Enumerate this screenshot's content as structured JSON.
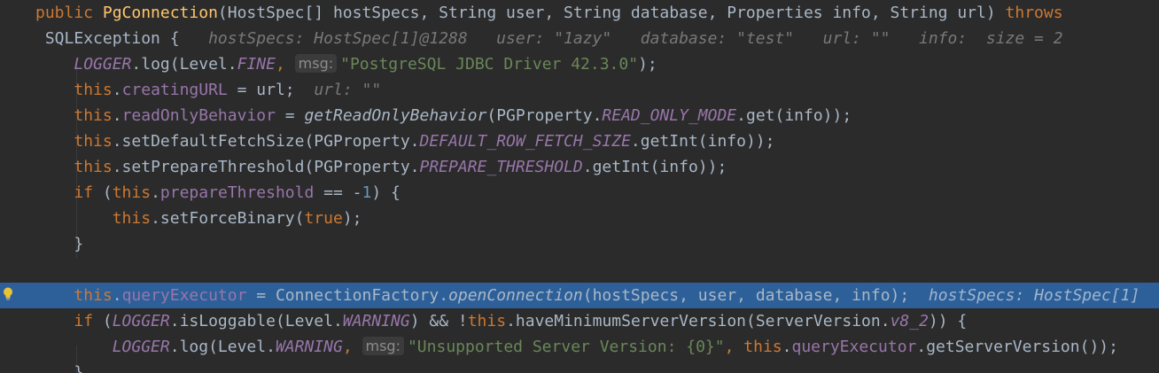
{
  "editor": {
    "lines": [
      {
        "indent": "",
        "tokens": [
          {
            "t": "public ",
            "c": "kw"
          },
          {
            "t": "PgConnection",
            "c": "ctor"
          },
          {
            "t": "(HostSpec[] hostSpecs, String user, String database, Properties info, String url) ",
            "c": "plain"
          },
          {
            "t": "throws",
            "c": "kw"
          }
        ]
      },
      {
        "indent": " ",
        "tokens": [
          {
            "t": "SQLException {",
            "c": "plain"
          },
          {
            "t": "   hostSpecs: HostSpec[1]@1288   user: \"1azy\"   database: \"test\"   url: \"\"   info:  size = 2",
            "c": "hint"
          }
        ]
      },
      {
        "indent": "    ",
        "tokens": [
          {
            "t": "LOGGER",
            "c": "sfield"
          },
          {
            "t": ".log(Level.",
            "c": "plain"
          },
          {
            "t": "FINE",
            "c": "sfield"
          },
          {
            "t": ", ",
            "c": "kw"
          },
          {
            "t": "msg:",
            "c": "param-hint"
          },
          {
            "t": "\"PostgreSQL JDBC Driver 42.3.0\"",
            "c": "str"
          },
          {
            "t": ");",
            "c": "plain"
          }
        ]
      },
      {
        "indent": "    ",
        "tokens": [
          {
            "t": "this",
            "c": "kw"
          },
          {
            "t": ".",
            "c": "plain"
          },
          {
            "t": "creatingURL",
            "c": "field"
          },
          {
            "t": " = url;",
            "c": "plain"
          },
          {
            "t": "  url: \"\"",
            "c": "hint"
          }
        ]
      },
      {
        "indent": "    ",
        "tokens": [
          {
            "t": "this",
            "c": "kw"
          },
          {
            "t": ".",
            "c": "plain"
          },
          {
            "t": "readOnlyBehavior",
            "c": "field"
          },
          {
            "t": " = ",
            "c": "plain"
          },
          {
            "t": "getReadOnlyBehavior",
            "c": "smeth"
          },
          {
            "t": "(PGProperty.",
            "c": "plain"
          },
          {
            "t": "READ_ONLY_MODE",
            "c": "sfield"
          },
          {
            "t": ".get(info));",
            "c": "plain"
          }
        ]
      },
      {
        "indent": "    ",
        "tokens": [
          {
            "t": "this",
            "c": "kw"
          },
          {
            "t": ".setDefaultFetchSize(PGProperty.",
            "c": "plain"
          },
          {
            "t": "DEFAULT_ROW_FETCH_SIZE",
            "c": "sfield"
          },
          {
            "t": ".getInt(info));",
            "c": "plain"
          }
        ]
      },
      {
        "indent": "    ",
        "tokens": [
          {
            "t": "this",
            "c": "kw"
          },
          {
            "t": ".setPrepareThreshold(PGProperty.",
            "c": "plain"
          },
          {
            "t": "PREPARE_THRESHOLD",
            "c": "sfield"
          },
          {
            "t": ".getInt(info));",
            "c": "plain"
          }
        ]
      },
      {
        "indent": "    ",
        "tokens": [
          {
            "t": "if ",
            "c": "kw"
          },
          {
            "t": "(",
            "c": "plain"
          },
          {
            "t": "this",
            "c": "kw"
          },
          {
            "t": ".",
            "c": "plain"
          },
          {
            "t": "prepareThreshold",
            "c": "field"
          },
          {
            "t": " == -",
            "c": "plain"
          },
          {
            "t": "1",
            "c": "num"
          },
          {
            "t": ") {",
            "c": "plain"
          }
        ]
      },
      {
        "indent": "        ",
        "tokens": [
          {
            "t": "this",
            "c": "kw"
          },
          {
            "t": ".setForceBinary(",
            "c": "plain"
          },
          {
            "t": "true",
            "c": "kw"
          },
          {
            "t": ");",
            "c": "plain"
          }
        ]
      },
      {
        "indent": "    ",
        "tokens": [
          {
            "t": "}",
            "c": "plain"
          }
        ]
      },
      {
        "indent": "",
        "tokens": []
      },
      {
        "indent": "    ",
        "exec": true,
        "tokens": [
          {
            "t": "this",
            "c": "kw"
          },
          {
            "t": ".",
            "c": "plain"
          },
          {
            "t": "queryExecutor",
            "c": "field"
          },
          {
            "t": " = ConnectionFactory.",
            "c": "plain"
          },
          {
            "t": "openConnection",
            "c": "smeth"
          },
          {
            "t": "(hostSpecs, user, database, info);",
            "c": "plain"
          },
          {
            "t": "  hostSpecs: HostSpec[1]",
            "c": "hint"
          }
        ]
      },
      {
        "indent": "    ",
        "tokens": [
          {
            "t": "if ",
            "c": "kw"
          },
          {
            "t": "(",
            "c": "plain"
          },
          {
            "t": "LOGGER",
            "c": "sfield"
          },
          {
            "t": ".isLoggable(Level.",
            "c": "plain"
          },
          {
            "t": "WARNING",
            "c": "sfield"
          },
          {
            "t": ") && !",
            "c": "plain"
          },
          {
            "t": "this",
            "c": "kw"
          },
          {
            "t": ".haveMinimumServerVersion(ServerVersion.",
            "c": "plain"
          },
          {
            "t": "v8_2",
            "c": "sfield"
          },
          {
            "t": ")) {",
            "c": "plain"
          }
        ]
      },
      {
        "indent": "        ",
        "tokens": [
          {
            "t": "LOGGER",
            "c": "sfield"
          },
          {
            "t": ".log(Level.",
            "c": "plain"
          },
          {
            "t": "WARNING",
            "c": "sfield"
          },
          {
            "t": ", ",
            "c": "kw"
          },
          {
            "t": "msg:",
            "c": "param-hint"
          },
          {
            "t": "\"Unsupported Server Version: {0}\"",
            "c": "str"
          },
          {
            "t": ", ",
            "c": "kw"
          },
          {
            "t": "this",
            "c": "kw"
          },
          {
            "t": ".",
            "c": "plain"
          },
          {
            "t": "queryExecutor",
            "c": "field"
          },
          {
            "t": ".getServerVersion());",
            "c": "plain"
          }
        ]
      },
      {
        "indent": "    ",
        "tokens": [
          {
            "t": "}",
            "c": "plain"
          }
        ]
      }
    ]
  },
  "gutter": {
    "exec_line_icon": "lightbulb-icon",
    "exec_line_icon_color": "#e8c33a"
  },
  "colors": {
    "background": "#2b2b2b",
    "execution_line": "#2d6099",
    "keyword": "#cc7832",
    "field": "#9876aa",
    "string": "#6a8759",
    "number": "#6897bb",
    "method_decl": "#ffc66d",
    "text": "#a9b7c6",
    "inline_hint": "#787878"
  }
}
